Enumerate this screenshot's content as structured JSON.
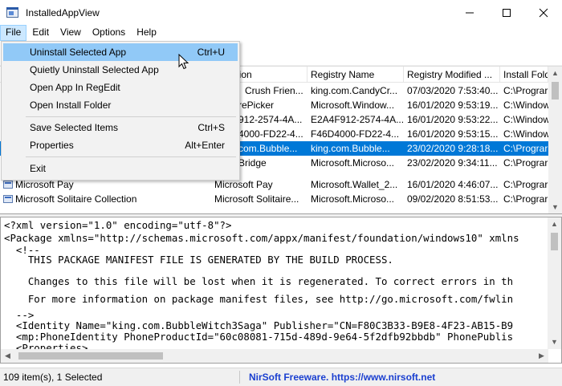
{
  "window": {
    "title": "InstalledAppView"
  },
  "menubar": {
    "items": [
      "File",
      "Edit",
      "View",
      "Options",
      "Help"
    ]
  },
  "file_menu": {
    "items": [
      {
        "label": "Uninstall Selected App",
        "shortcut": "Ctrl+U"
      },
      {
        "label": "Quietly Uninstall Selected App",
        "shortcut": ""
      },
      {
        "label": "Open App In RegEdit",
        "shortcut": ""
      },
      {
        "label": "Open Install Folder",
        "shortcut": ""
      },
      {
        "label": "Save Selected Items",
        "shortcut": "Ctrl+S"
      },
      {
        "label": "Properties",
        "shortcut": "Alt+Enter"
      },
      {
        "label": "Exit",
        "shortcut": ""
      }
    ]
  },
  "list": {
    "columns": [
      "",
      "ersion",
      "Registry Name",
      "Registry Modified ...",
      "Install Fold"
    ],
    "rows": [
      {
        "name": "",
        "version": "Crush Frien...",
        "registry_name": "king.com.CandyCr...",
        "modified": "07/03/2020 7:53:40...",
        "folder": "C:\\Prograr"
      },
      {
        "name": "",
        "version": "rePicker",
        "registry_name": "Microsoft.Window...",
        "modified": "16/01/2020 9:53:19...",
        "folder": "C:\\Window"
      },
      {
        "name": "",
        "version": "912-2574-4A...",
        "registry_name": "E2A4F912-2574-4A...",
        "modified": "16/01/2020 9:53:22...",
        "folder": "C:\\Window"
      },
      {
        "name": "",
        "version": "4000-FD22-4...",
        "registry_name": "F46D4000-FD22-4...",
        "modified": "16/01/2020 9:53:15...",
        "folder": "C:\\Window"
      },
      {
        "name": "",
        "version": "com.Bubble...",
        "registry_name": "king.com.Bubble...",
        "modified": "23/02/2020 9:28:18...",
        "folder": "C:\\Prograr"
      },
      {
        "name": "",
        "version": "Bridge",
        "registry_name": "Microsoft.Microso...",
        "modified": "23/02/2020 9:34:11...",
        "folder": "C:\\Prograr"
      },
      {
        "name": "Microsoft Pay",
        "version": "Microsoft Pay",
        "registry_name": "Microsoft.Wallet_2...",
        "modified": "16/01/2020 4:46:07...",
        "folder": "C:\\Prograr"
      },
      {
        "name": "Microsoft Solitaire Collection",
        "version": "Microsoft Solitaire...",
        "registry_name": "Microsoft.Microso...",
        "modified": "09/02/2020 8:51:53...",
        "folder": "C:\\Prograr"
      }
    ]
  },
  "xml": {
    "lines": [
      "<?xml version=\"1.0\" encoding=\"utf-8\"?>",
      "<Package xmlns=\"http://schemas.microsoft.com/appx/manifest/foundation/windows10\" xmlns",
      "  <!--",
      "    THIS PACKAGE MANIFEST FILE IS GENERATED BY THE BUILD PROCESS.",
      "",
      "    Changes to this file will be lost when it is regenerated. To correct errors in th",
      "",
      "    For more information on package manifest files, see http://go.microsoft.com/fwlin",
      "  -->",
      "  <Identity Name=\"king.com.BubbleWitch3Saga\" Publisher=\"CN=F80C3B33-B9E8-4F23-AB15-B9",
      "  <mp:PhoneIdentity PhoneProductId=\"60c08081-715d-489d-9e64-5f2dfb92bbdb\" PhonePublis",
      "  <Properties>"
    ]
  },
  "status": {
    "count": "109 item(s), 1 Selected",
    "credit": "NirSoft Freeware. https://www.nirsoft.net"
  },
  "colors": {
    "selection": "#0078d7",
    "menu_highlight": "#91c9f7",
    "link": "#1a3fd0"
  }
}
